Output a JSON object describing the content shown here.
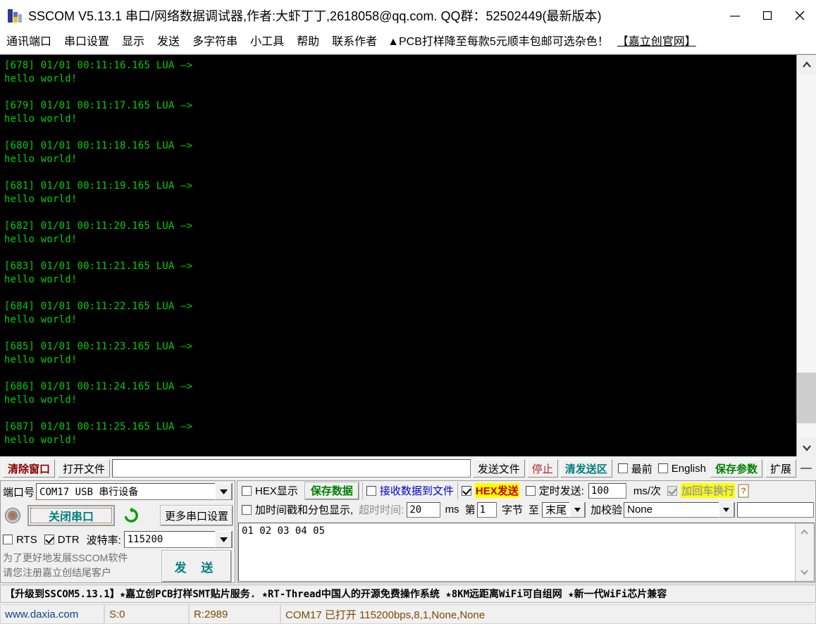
{
  "window": {
    "title": "SSCOM V5.13.1 串口/网络数据调试器,作者:大虾丁丁,2618058@qq.com. QQ群：52502449(最新版本)",
    "icon": "sscom-logo-icon",
    "minimize": "minimize-icon",
    "maximize": "maximize-icon",
    "close": "close-icon"
  },
  "menu": {
    "items": [
      {
        "label": "通讯端口"
      },
      {
        "label": "串口设置"
      },
      {
        "label": "显示"
      },
      {
        "label": "发送"
      },
      {
        "label": "多字符串"
      },
      {
        "label": "小工具"
      },
      {
        "label": "帮助"
      },
      {
        "label": "联系作者"
      }
    ],
    "ad": "▲PCB打样降至每款5元顺丰包邮可选杂色！",
    "ad_link": "【嘉立创官网】"
  },
  "terminal": {
    "text_color": "#00d000",
    "background": "#000000",
    "lines": [
      "[678] 01/01 00:11:16.165 LUA —>",
      "hello world!",
      "",
      "[679] 01/01 00:11:17.165 LUA —>",
      "hello world!",
      "",
      "[680] 01/01 00:11:18.165 LUA —>",
      "hello world!",
      "",
      "[681] 01/01 00:11:19.165 LUA —>",
      "hello world!",
      "",
      "[682] 01/01 00:11:20.165 LUA —>",
      "hello world!",
      "",
      "[683] 01/01 00:11:21.165 LUA —>",
      "hello world!",
      "",
      "[684] 01/01 00:11:22.165 LUA —>",
      "hello world!",
      "",
      "[685] 01/01 00:11:23.165 LUA —>",
      "hello world!",
      "",
      "[686] 01/01 00:11:24.165 LUA —>",
      "hello world!",
      "",
      "[687] 01/01 00:11:25.165 LUA —>",
      "hello world!"
    ],
    "scroll_up": "scroll-up-icon",
    "scroll_down": "scroll-down-icon"
  },
  "toolbar": {
    "clear_window": "清除窗口",
    "open_file": "打开文件",
    "file_path_value": "",
    "send_file": "发送文件",
    "stop": "停止",
    "clear_send": "清发送区",
    "topmost": "最前",
    "topmost_checked": false,
    "english": "English",
    "english_checked": false,
    "save_params": "保存参数",
    "extend": "扩展",
    "collapse": "—"
  },
  "port_panel": {
    "port_label": "端口号",
    "port_value": "COM17 USB 串行设备",
    "close_port_button": "关闭串口",
    "refresh_icon": "refresh-icon",
    "led_icon": "status-led-icon",
    "more_settings": "更多串口设置",
    "rts_label": "RTS",
    "rts_checked": false,
    "dtr_label": "DTR",
    "dtr_checked": true,
    "baud_label": "波特率:",
    "baud_value": "115200",
    "register_line1": "为了更好地发展SSCOM软件",
    "register_line2": "请您注册嘉立创结尾客户",
    "send_button": "发 送"
  },
  "options_panel": {
    "hex_display": "HEX显示",
    "hex_display_checked": false,
    "save_data": "保存数据",
    "recv_to_file": "接收数据到文件",
    "recv_to_file_checked": false,
    "hex_send": "HEX发送",
    "hex_send_checked": true,
    "timed_send": "定时发送:",
    "timed_send_checked": false,
    "timed_send_value": "100",
    "ms_per": "ms/次",
    "add_crlf": "加回车换行",
    "add_crlf_checked": true,
    "help_icon": "help-icon",
    "timestamp_label": "加时间戳和分包显示,",
    "timestamp_checked": false,
    "timeout_label": "超时时间:",
    "timeout_value": "20",
    "ms_unit": "ms",
    "byte_from_label": "第",
    "byte_from_value": "1",
    "byte_label": "字节",
    "byte_to_label": "至",
    "byte_to_value": "末尾",
    "checksum_label": "加校验",
    "checksum_value": "None",
    "extra_value": ""
  },
  "send_area": {
    "value": "01 02 03 04 05"
  },
  "ad_bar": {
    "text": "【升级到SSCOM5.13.1】★嘉立创PCB打样SMT贴片服务. ★RT-Thread中国人的开源免费操作系统 ★8KM远距离WiFi可自组网 ★新一代WiFi芯片兼容"
  },
  "status_bar": {
    "website": "www.daxia.com",
    "sent": "S:0",
    "received": "R:2989",
    "connection": "COM17 已打开  115200bps,8,1,None,None"
  }
}
